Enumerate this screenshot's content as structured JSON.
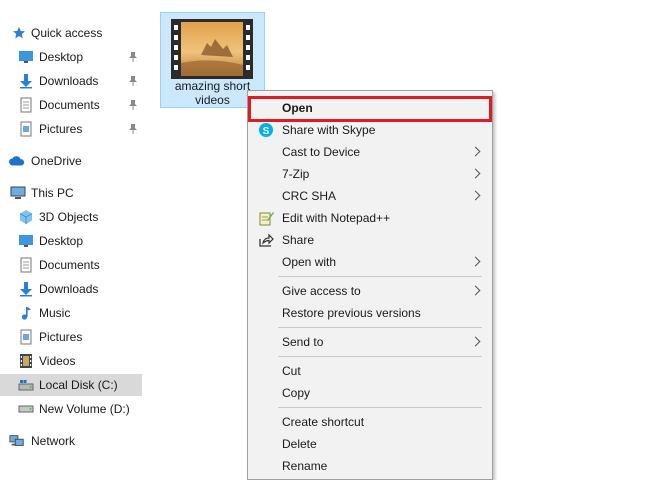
{
  "nav": {
    "quick_access": "Quick access",
    "quick_items": [
      {
        "label": "Desktop",
        "icon": "desktop-icon",
        "pinned": true
      },
      {
        "label": "Downloads",
        "icon": "downloads-icon",
        "pinned": true
      },
      {
        "label": "Documents",
        "icon": "documents-icon",
        "pinned": true
      },
      {
        "label": "Pictures",
        "icon": "pictures-icon",
        "pinned": true
      }
    ],
    "onedrive": "OneDrive",
    "this_pc": "This PC",
    "pc_items": [
      {
        "label": "3D Objects",
        "icon": "3d-objects-icon"
      },
      {
        "label": "Desktop",
        "icon": "desktop-icon"
      },
      {
        "label": "Documents",
        "icon": "documents-icon"
      },
      {
        "label": "Downloads",
        "icon": "downloads-icon"
      },
      {
        "label": "Music",
        "icon": "music-icon"
      },
      {
        "label": "Pictures",
        "icon": "pictures-icon"
      },
      {
        "label": "Videos",
        "icon": "videos-icon"
      },
      {
        "label": "Local Disk (C:)",
        "icon": "local-disk-icon"
      },
      {
        "label": "New Volume (D:)",
        "icon": "drive-icon"
      }
    ],
    "network": "Network"
  },
  "file": {
    "name": "amazing short videos",
    "icon": "video-file-icon"
  },
  "context_menu": {
    "items": [
      {
        "label": "Open",
        "bold": true
      },
      {
        "label": "Share with Skype",
        "icon": "skype-icon"
      },
      {
        "label": "Cast to Device",
        "submenu": true
      },
      {
        "label": "7-Zip",
        "submenu": true
      },
      {
        "label": "CRC SHA",
        "submenu": true
      },
      {
        "label": "Edit with Notepad++",
        "icon": "notepad-plus-plus-icon"
      },
      {
        "label": "Share",
        "icon": "share-icon"
      },
      {
        "label": "Open with",
        "submenu": true
      },
      {
        "label": "Give access to",
        "submenu": true
      },
      {
        "label": "Restore previous versions"
      },
      {
        "label": "Send to",
        "submenu": true
      },
      {
        "label": "Cut"
      },
      {
        "label": "Copy"
      },
      {
        "label": "Create shortcut"
      },
      {
        "label": "Delete"
      },
      {
        "label": "Rename"
      }
    ]
  },
  "colors": {
    "selection": "#cce8ff",
    "highlight_box": "#e01b24",
    "menu_bg": "#f2f2f2",
    "folder_blue": "#2d7fd3"
  }
}
